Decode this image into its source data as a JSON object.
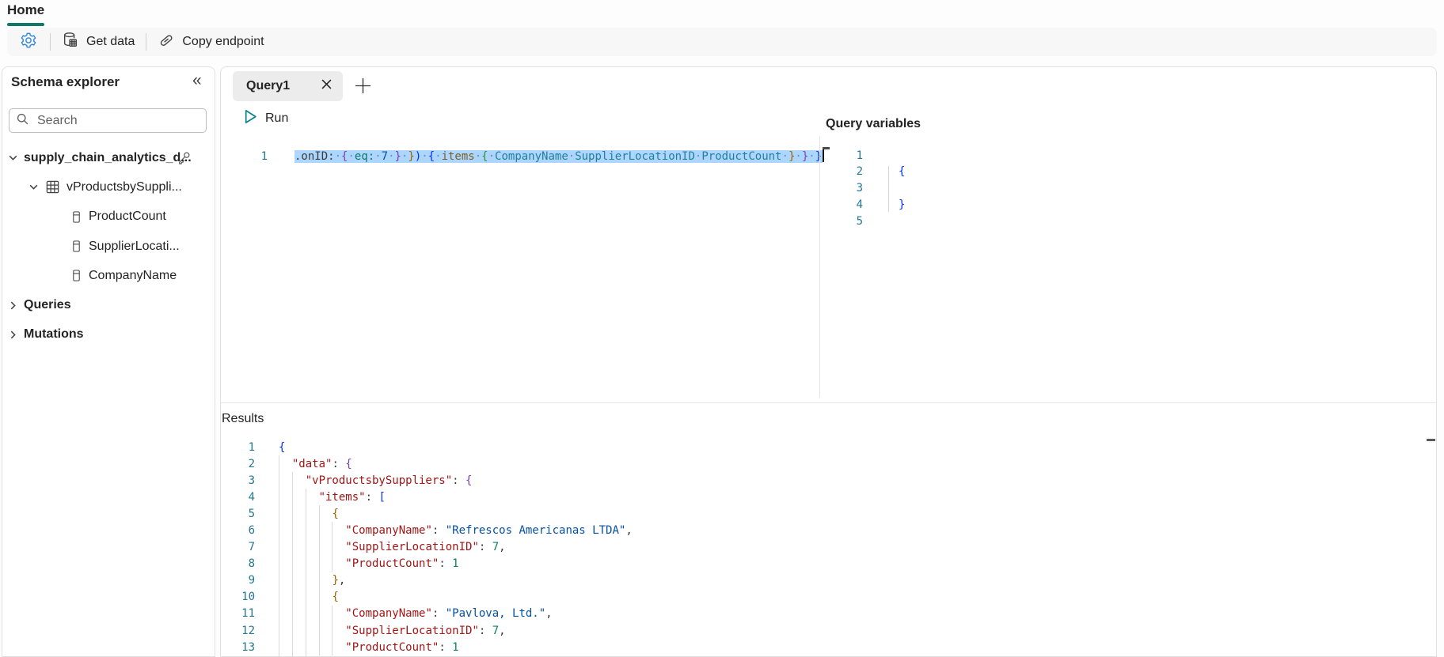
{
  "ribbon": {
    "home_tab": "Home",
    "get_data": "Get data",
    "copy_endpoint": "Copy endpoint",
    "accent_color": "#117865",
    "gear_color": "#2b88d8"
  },
  "schema_explorer": {
    "title": "Schema explorer",
    "search_placeholder": "Search",
    "tree": [
      {
        "label": "supply_chain_analytics_d...",
        "level": 0,
        "chevron": "down",
        "icon": null,
        "trailing": "key",
        "bold": true
      },
      {
        "label": "vProductsbySuppli...",
        "level": 1,
        "chevron": "down",
        "icon": "table",
        "trailing": null,
        "bold": false
      },
      {
        "label": "ProductCount",
        "level": 2,
        "chevron": null,
        "icon": "field",
        "trailing": null,
        "bold": false
      },
      {
        "label": "SupplierLocati...",
        "level": 2,
        "chevron": null,
        "icon": "field",
        "trailing": null,
        "bold": false
      },
      {
        "label": "CompanyName",
        "level": 2,
        "chevron": null,
        "icon": "field",
        "trailing": null,
        "bold": false
      },
      {
        "label": "Queries",
        "level": 0,
        "chevron": "right",
        "icon": null,
        "trailing": null,
        "bold": true
      },
      {
        "label": "Mutations",
        "level": 0,
        "chevron": null,
        "icon": null,
        "trailing": null,
        "bold": true,
        "chevron2": "right"
      }
    ]
  },
  "query_tab": {
    "label": "Query1"
  },
  "run_label": "Run",
  "query_editor": {
    "line_number": "1",
    "selection_color": "#add6ff",
    "tokens": [
      {
        "t": ".onID:",
        "c": "k"
      },
      {
        "t": "·",
        "c": "ws"
      },
      {
        "t": "{",
        "c": "bpurple"
      },
      {
        "t": "·",
        "c": "ws"
      },
      {
        "t": "eq:",
        "c": "teal"
      },
      {
        "t": "·",
        "c": "ws"
      },
      {
        "t": "7",
        "c": "numblue"
      },
      {
        "t": "·",
        "c": "ws"
      },
      {
        "t": "}",
        "c": "bpurple"
      },
      {
        "t": "·",
        "c": "ws"
      },
      {
        "t": "}",
        "c": "bgold"
      },
      {
        "t": ")",
        "c": "bblue"
      },
      {
        "t": "·",
        "c": "ws"
      },
      {
        "t": "{",
        "c": "bblue"
      },
      {
        "t": "·",
        "c": "ws"
      },
      {
        "t": "items",
        "c": "field"
      },
      {
        "t": "·",
        "c": "ws"
      },
      {
        "t": "{",
        "c": "bgreen"
      },
      {
        "t": "·",
        "c": "ws"
      },
      {
        "t": "CompanyName",
        "c": "type"
      },
      {
        "t": "·",
        "c": "ws"
      },
      {
        "t": "SupplierLocationID",
        "c": "type"
      },
      {
        "t": "·",
        "c": "ws"
      },
      {
        "t": "ProductCount",
        "c": "type"
      },
      {
        "t": "·",
        "c": "ws"
      },
      {
        "t": "}",
        "c": "bgold"
      },
      {
        "t": "·",
        "c": "ws"
      },
      {
        "t": "}",
        "c": "bpurple"
      },
      {
        "t": "·",
        "c": "ws"
      },
      {
        "t": "}",
        "c": "bblue"
      }
    ]
  },
  "query_variables": {
    "title": "Query variables",
    "lines": [
      {
        "num": "1",
        "tokens": []
      },
      {
        "num": "2",
        "tokens": [
          {
            "t": "{",
            "c": "bblue"
          }
        ]
      },
      {
        "num": "3",
        "tokens": []
      },
      {
        "num": "4",
        "tokens": [
          {
            "t": "}",
            "c": "bblue"
          }
        ]
      },
      {
        "num": "5",
        "tokens": []
      }
    ]
  },
  "results": {
    "title": "Results",
    "lines": [
      {
        "num": "1",
        "tokens": [
          {
            "t": "{",
            "c": "bblue"
          }
        ]
      },
      {
        "num": "2",
        "tokens": [
          {
            "t": "  ",
            "c": "sp"
          },
          {
            "t": "\"data\"",
            "c": "key"
          },
          {
            "t": ": ",
            "c": "p"
          },
          {
            "t": "{",
            "c": "bpurple"
          }
        ]
      },
      {
        "num": "3",
        "tokens": [
          {
            "t": "    ",
            "c": "sp"
          },
          {
            "t": "\"vProductsbySuppliers\"",
            "c": "key"
          },
          {
            "t": ": ",
            "c": "p"
          },
          {
            "t": "{",
            "c": "bpurple"
          }
        ]
      },
      {
        "num": "4",
        "tokens": [
          {
            "t": "      ",
            "c": "sp"
          },
          {
            "t": "\"items\"",
            "c": "key"
          },
          {
            "t": ": ",
            "c": "p"
          },
          {
            "t": "[",
            "c": "bblue"
          }
        ]
      },
      {
        "num": "5",
        "tokens": [
          {
            "t": "        ",
            "c": "sp"
          },
          {
            "t": "{",
            "c": "bgold"
          }
        ]
      },
      {
        "num": "6",
        "tokens": [
          {
            "t": "          ",
            "c": "sp"
          },
          {
            "t": "\"CompanyName\"",
            "c": "key"
          },
          {
            "t": ": ",
            "c": "p"
          },
          {
            "t": "\"Refrescos Americanas LTDA\"",
            "c": "str"
          },
          {
            "t": ",",
            "c": "p"
          }
        ]
      },
      {
        "num": "7",
        "tokens": [
          {
            "t": "          ",
            "c": "sp"
          },
          {
            "t": "\"SupplierLocationID\"",
            "c": "key"
          },
          {
            "t": ": ",
            "c": "p"
          },
          {
            "t": "7",
            "c": "num"
          },
          {
            "t": ",",
            "c": "p"
          }
        ]
      },
      {
        "num": "8",
        "tokens": [
          {
            "t": "          ",
            "c": "sp"
          },
          {
            "t": "\"ProductCount\"",
            "c": "key"
          },
          {
            "t": ": ",
            "c": "p"
          },
          {
            "t": "1",
            "c": "num"
          }
        ]
      },
      {
        "num": "9",
        "tokens": [
          {
            "t": "        ",
            "c": "sp"
          },
          {
            "t": "}",
            "c": "bgold"
          },
          {
            "t": ",",
            "c": "p"
          }
        ]
      },
      {
        "num": "10",
        "tokens": [
          {
            "t": "        ",
            "c": "sp"
          },
          {
            "t": "{",
            "c": "bgold"
          }
        ]
      },
      {
        "num": "11",
        "tokens": [
          {
            "t": "          ",
            "c": "sp"
          },
          {
            "t": "\"CompanyName\"",
            "c": "key"
          },
          {
            "t": ": ",
            "c": "p"
          },
          {
            "t": "\"Pavlova, Ltd.\"",
            "c": "str"
          },
          {
            "t": ",",
            "c": "p"
          }
        ]
      },
      {
        "num": "12",
        "tokens": [
          {
            "t": "          ",
            "c": "sp"
          },
          {
            "t": "\"SupplierLocationID\"",
            "c": "key"
          },
          {
            "t": ": ",
            "c": "p"
          },
          {
            "t": "7",
            "c": "num"
          },
          {
            "t": ",",
            "c": "p"
          }
        ]
      },
      {
        "num": "13",
        "tokens": [
          {
            "t": "          ",
            "c": "sp"
          },
          {
            "t": "\"ProductCount\"",
            "c": "key"
          },
          {
            "t": ": ",
            "c": "p"
          },
          {
            "t": "1",
            "c": "num"
          }
        ]
      }
    ]
  }
}
